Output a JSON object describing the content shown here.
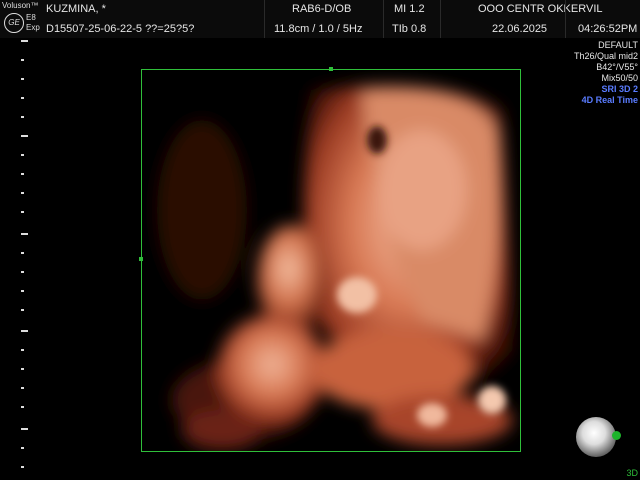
{
  "header": {
    "brand": "Voluson™",
    "logo": "GE",
    "model_line1": "E8",
    "model_line2": "Exp",
    "patient_name": "KUZMINA,  *",
    "patient_id": "D15507-25-06-22-5  ??=25?5?",
    "probe": "RAB6-D/OB",
    "probe_settings": "11.8cm / 1.0 /  5Hz",
    "mi": "MI  1.2",
    "tib": "TIb  0.8",
    "institution": "OOO CENTR OKKERVIL",
    "date": "22.06.2025",
    "time": "04:26:52PM"
  },
  "params": {
    "preset": "DEFAULT",
    "quality": "Th26/Qual mid2",
    "angle": "B42°/V55°",
    "mix": "Mix50/50",
    "sri": "SRI 3D 2",
    "mode": "4D Real Time"
  },
  "footer": {
    "mode_label": "3D"
  },
  "colors": {
    "accent_green": "#2fbf3a",
    "param_blue": "#5a7cff"
  },
  "icons": {
    "logo": "ge-logo-icon",
    "orientation": "orientation-sphere-icon"
  }
}
